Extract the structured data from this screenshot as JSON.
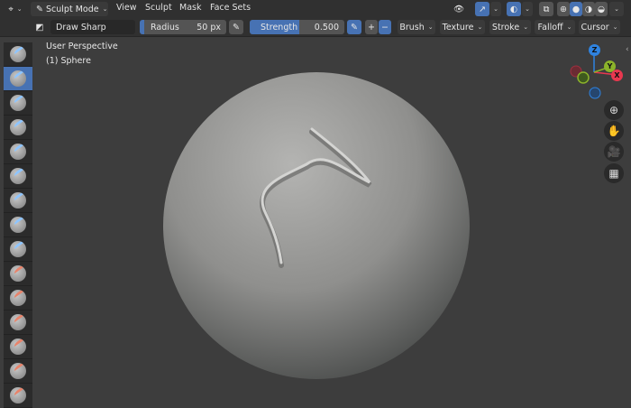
{
  "header": {
    "mode": "Sculpt Mode",
    "menus": [
      "View",
      "Sculpt",
      "Mask",
      "Face Sets"
    ]
  },
  "tool_settings": {
    "brush_name": "Draw Sharp",
    "radius_label": "Radius",
    "radius_value": "50 px",
    "strength_label": "Strength",
    "strength_value": "0.500",
    "plus": "+",
    "minus": "−",
    "dropdowns": [
      "Brush",
      "Texture",
      "Stroke",
      "Falloff",
      "Cursor"
    ]
  },
  "viewport": {
    "view_name": "User Perspective",
    "object": "(1) Sphere",
    "shading": "solid",
    "accent": "#4772b3"
  },
  "gizmo": {
    "z": "Z",
    "y": "Y",
    "x": "X",
    "colors": {
      "x": "#e8384f",
      "y": "#8cb32a",
      "z": "#2f83e0"
    }
  },
  "nav_buttons": [
    "zoom-icon",
    "hand-icon",
    "camera-icon",
    "grid-icon"
  ],
  "toolbar": {
    "tools": [
      "draw",
      "draw-sharp",
      "clay",
      "clay-strips",
      "clay-thumb",
      "layer",
      "inflate",
      "blob",
      "crease",
      "smooth",
      "flatten",
      "fill",
      "scrape",
      "multiplane-scrape",
      "pinch"
    ],
    "active_index": 1
  }
}
